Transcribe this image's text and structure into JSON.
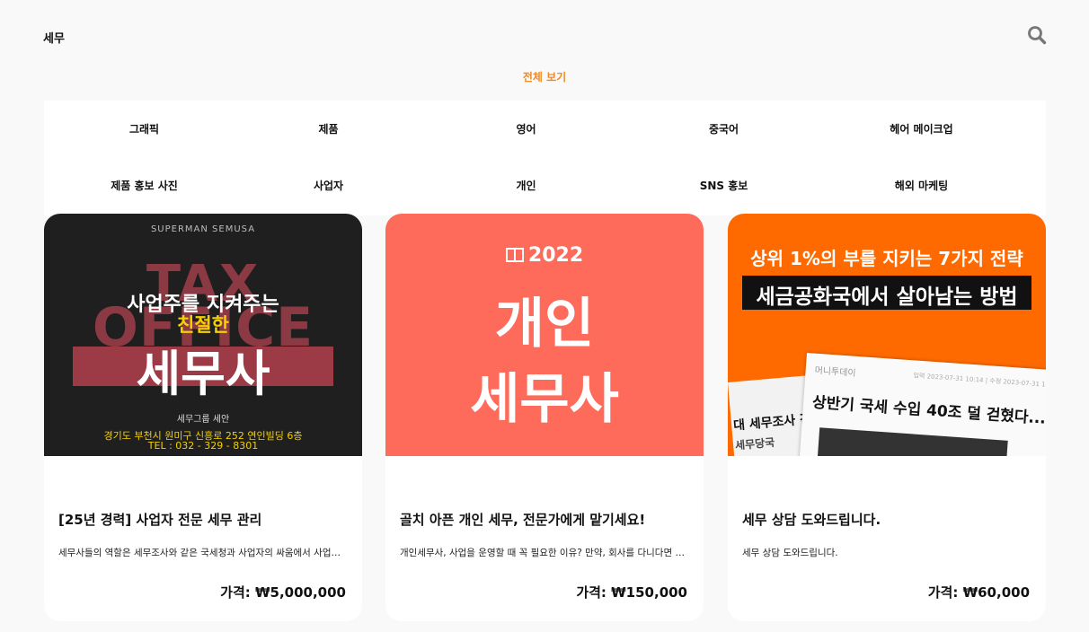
{
  "header": {
    "title": "세무",
    "search_icon": "search-icon"
  },
  "filter": {
    "view_all": "전체 보기",
    "active_color": "#f08a24"
  },
  "categories": [
    "그래픽",
    "제품",
    "영어",
    "중국어",
    "헤어 메이크업",
    "제품 홍보 사진",
    "사업자",
    "개인",
    "SNS 홍보",
    "해외 마케팅"
  ],
  "cards": [
    {
      "title": "[25년 경력] 사업자 전문 세무 관리",
      "desc": "세무사들의 역할은 세무조사와 같은 국세청과 사업자의 싸움에서 사업자가...",
      "price": "가격: ₩5,000,000",
      "image": {
        "brand": "SUPERMAN SEMUSA",
        "bg_word_1": "TAX",
        "bg_word_2": "OFFICE",
        "line1": "사업주를 지켜주는",
        "line2": "친절한",
        "line3": "세무사",
        "org": "세무그룹 세안",
        "address": "경기도 부천시 원미구 신흥로 252 연인빌딩 6층",
        "tel": "TEL : 032 - 329 - 8301",
        "bg_color": "#1f1f1f",
        "accent_color": "#f5d000"
      }
    },
    {
      "title": "골치 아픈 개인 세무, 전문가에게 맡기세요!",
      "desc": "개인세무사, 사업을 운영할 때 꼭 필요한 이유? 만약, 회사를 다니다면 세...",
      "price": "가격: ₩150,000",
      "image": {
        "year": "2022",
        "line1": "개인",
        "line2": "세무사",
        "bg_color": "#ff6b5b"
      }
    },
    {
      "title": "세무 상담 도와드립니다.",
      "desc": "세무 상담 도와드립니다.",
      "price": "가격: ₩60,000",
      "image": {
        "headline_top": "상위 1%의 부를 지키는 7가지 전략",
        "headline_box": "세금공화국에서 살아남는 방법",
        "paper_source": "머니투데이",
        "paper_date": "입력 2023-07-31 10:14 | 수정 2023-07-31 10:",
        "paper_headline": "상반기 국세 수입 40조 덜 걷혔다...",
        "paper_side_1": "대 세무조사 강화",
        "paper_side_2": "세무당국",
        "bg_color": "#ff6a00"
      }
    }
  ]
}
